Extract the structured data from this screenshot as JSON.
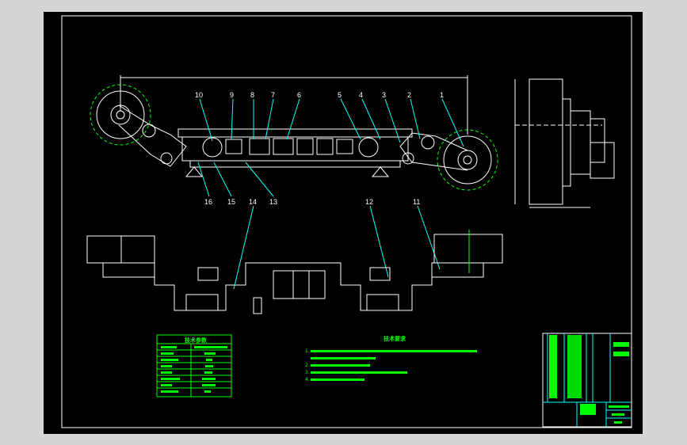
{
  "drawing": {
    "callouts_top": [
      "10",
      "9",
      "8",
      "7",
      "6",
      "5",
      "4",
      "3",
      "2",
      "1"
    ],
    "callouts_bottom": [
      "16",
      "15",
      "14",
      "13",
      "12",
      "11"
    ],
    "params_table_title": "技术参数",
    "requirements_title": "技术要求",
    "requirements": [
      "1.",
      "2.",
      "3.",
      "4."
    ],
    "colors": {
      "background": "#000000",
      "frame": "#ffffff",
      "geometry": "#ffffff",
      "annotation": "#00ff00",
      "table": "#00ffff"
    }
  }
}
